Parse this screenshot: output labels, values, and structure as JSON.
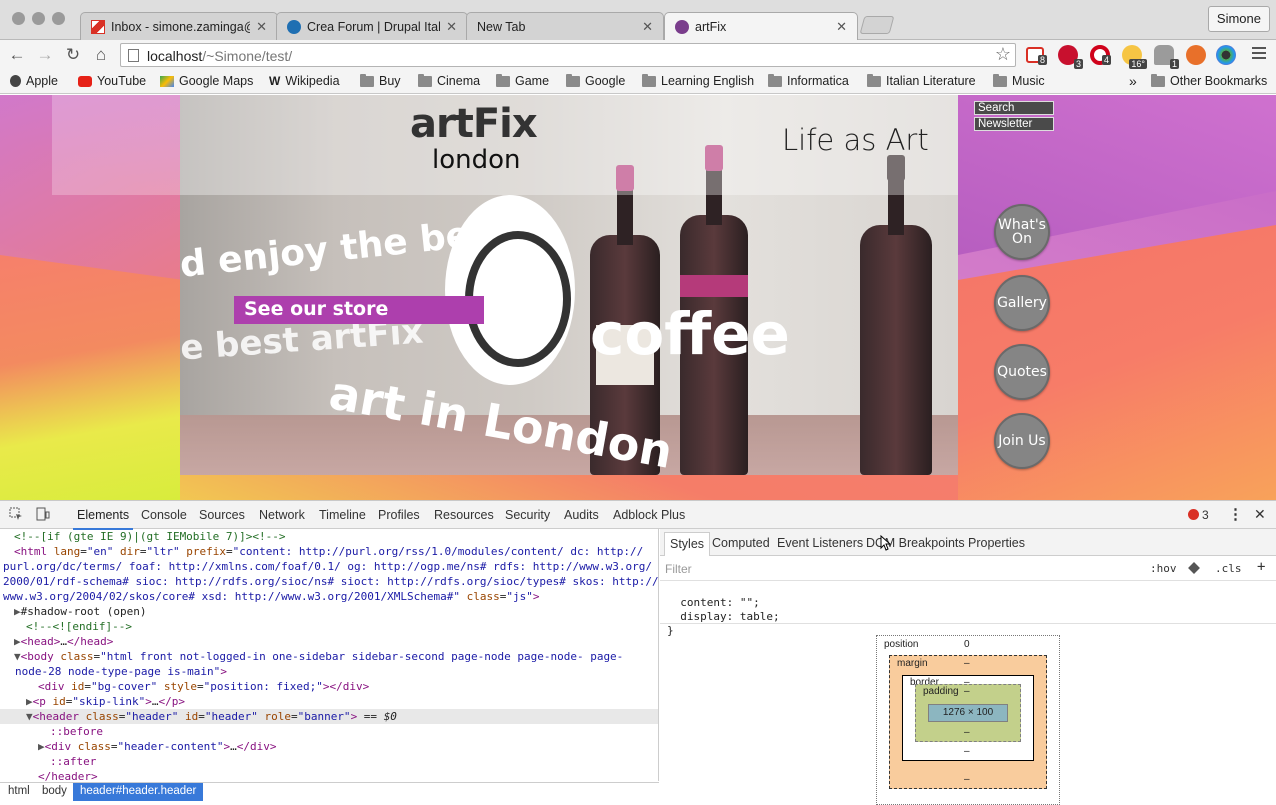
{
  "browser": {
    "tabs": [
      {
        "title": "Inbox - simone.zaminga@g",
        "favicon_color": "#d93025"
      },
      {
        "title": "Crea Forum | Drupal Italia",
        "favicon_color": "#1f6fb2"
      },
      {
        "title": "New Tab",
        "favicon_color": ""
      },
      {
        "title": "artFix",
        "favicon_color": "#7a3d8c"
      }
    ],
    "profile_name": "Simone",
    "url_host": "localhost",
    "url_path": "/~Simone/test/",
    "extension_badges": [
      "8",
      "3",
      "4",
      "16°",
      "1"
    ]
  },
  "bookmarks": {
    "items": [
      "Apple",
      "YouTube",
      "Google Maps",
      "Wikipedia",
      "Buy",
      "Cinema",
      "Game",
      "Google",
      "Learning English",
      "Informatica",
      "Italian Literature",
      "Music"
    ],
    "overflow": "»",
    "other": "Other Bookmarks"
  },
  "site": {
    "logo_top": "artFix",
    "logo_bottom": "london",
    "slogan": "Life as Art",
    "cta": "See our store",
    "side_links": [
      "Search",
      "Newsletter"
    ],
    "nav": [
      "What's On",
      "Gallery",
      "Quotes",
      "Join Us"
    ],
    "accent": "#ad3fad"
  },
  "devtools": {
    "tabs": [
      "Elements",
      "Console",
      "Sources",
      "Network",
      "Timeline",
      "Profiles",
      "Resources",
      "Security",
      "Audits",
      "Adblock Plus"
    ],
    "error_count": "3",
    "breadcrumbs": [
      "html",
      "body",
      "header#header.header"
    ],
    "styles_tabs": [
      "Styles",
      "Computed",
      "Event Listeners",
      "DOM Breakpoints",
      "Properties"
    ],
    "filter_placeholder": "Filter",
    "filter_hov": ":hov",
    "filter_cls": ".cls",
    "css_line1": "  content: \"\";",
    "css_line2": "  display: table;",
    "css_line3": "}",
    "box": {
      "position_label": "position",
      "position_value": "0",
      "margin_label": "margin",
      "border_label": "border",
      "padding_label": "padding",
      "dash": "–",
      "content_size": "1276 × 100"
    }
  }
}
